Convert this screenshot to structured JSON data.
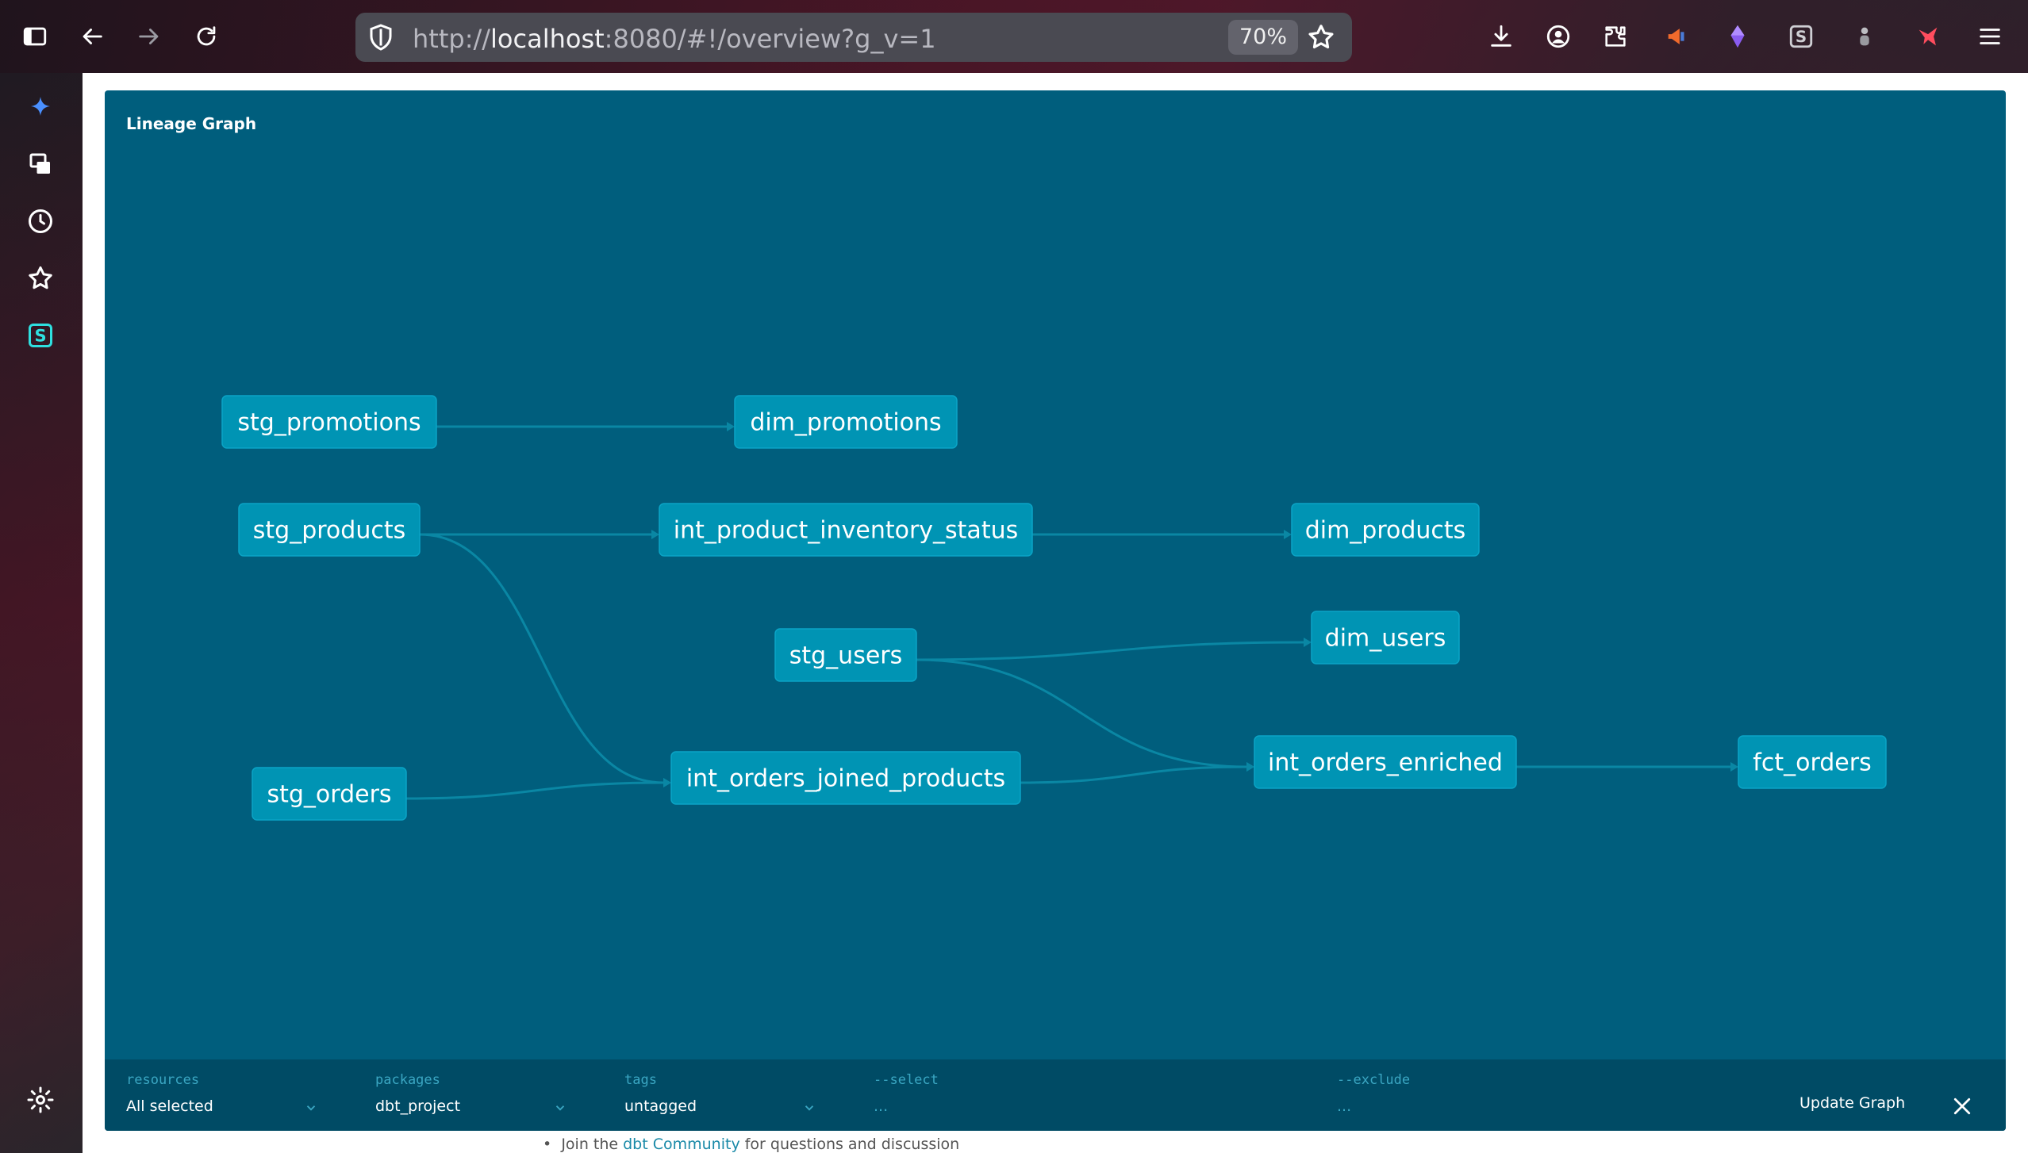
{
  "browser": {
    "url_prefix": "http://",
    "url_host": "localhost",
    "url_rest": ":8080/#!/overview?g_v=1",
    "zoom": "70%"
  },
  "lineage": {
    "title": "Lineage Graph",
    "nodes": [
      {
        "id": "stg_promotions",
        "label": "stg_promotions"
      },
      {
        "id": "dim_promotions",
        "label": "dim_promotions"
      },
      {
        "id": "stg_products",
        "label": "stg_products"
      },
      {
        "id": "int_product_inventory_status",
        "label": "int_product_inventory_status"
      },
      {
        "id": "dim_products",
        "label": "dim_products"
      },
      {
        "id": "stg_users",
        "label": "stg_users"
      },
      {
        "id": "dim_users",
        "label": "dim_users"
      },
      {
        "id": "stg_orders",
        "label": "stg_orders"
      },
      {
        "id": "int_orders_joined_products",
        "label": "int_orders_joined_products"
      },
      {
        "id": "int_orders_enriched",
        "label": "int_orders_enriched"
      },
      {
        "id": "fct_orders",
        "label": "fct_orders"
      }
    ],
    "edges": [
      {
        "from": "stg_promotions",
        "to": "dim_promotions"
      },
      {
        "from": "stg_products",
        "to": "int_product_inventory_status"
      },
      {
        "from": "int_product_inventory_status",
        "to": "dim_products"
      },
      {
        "from": "stg_products",
        "to": "int_orders_joined_products"
      },
      {
        "from": "stg_users",
        "to": "dim_users"
      },
      {
        "from": "stg_users",
        "to": "int_orders_enriched"
      },
      {
        "from": "stg_orders",
        "to": "int_orders_joined_products"
      },
      {
        "from": "int_orders_joined_products",
        "to": "int_orders_enriched"
      },
      {
        "from": "int_orders_enriched",
        "to": "fct_orders"
      }
    ]
  },
  "filters": {
    "resources": {
      "label": "resources",
      "value": "All selected"
    },
    "packages": {
      "label": "packages",
      "value": "dbt_project"
    },
    "tags": {
      "label": "tags",
      "value": "untagged"
    },
    "select": {
      "label": "--select",
      "value": "..."
    },
    "exclude": {
      "label": "--exclude",
      "value": "..."
    },
    "update_label": "Update Graph"
  },
  "footer": {
    "bullet": "•",
    "prefix": "Join the ",
    "link": "dbt Community",
    "suffix": " for questions and discussion"
  },
  "colors": {
    "panel_bg": "#005e7d",
    "node_fill": "#0094b4",
    "filterbar_bg": "#004b65"
  }
}
